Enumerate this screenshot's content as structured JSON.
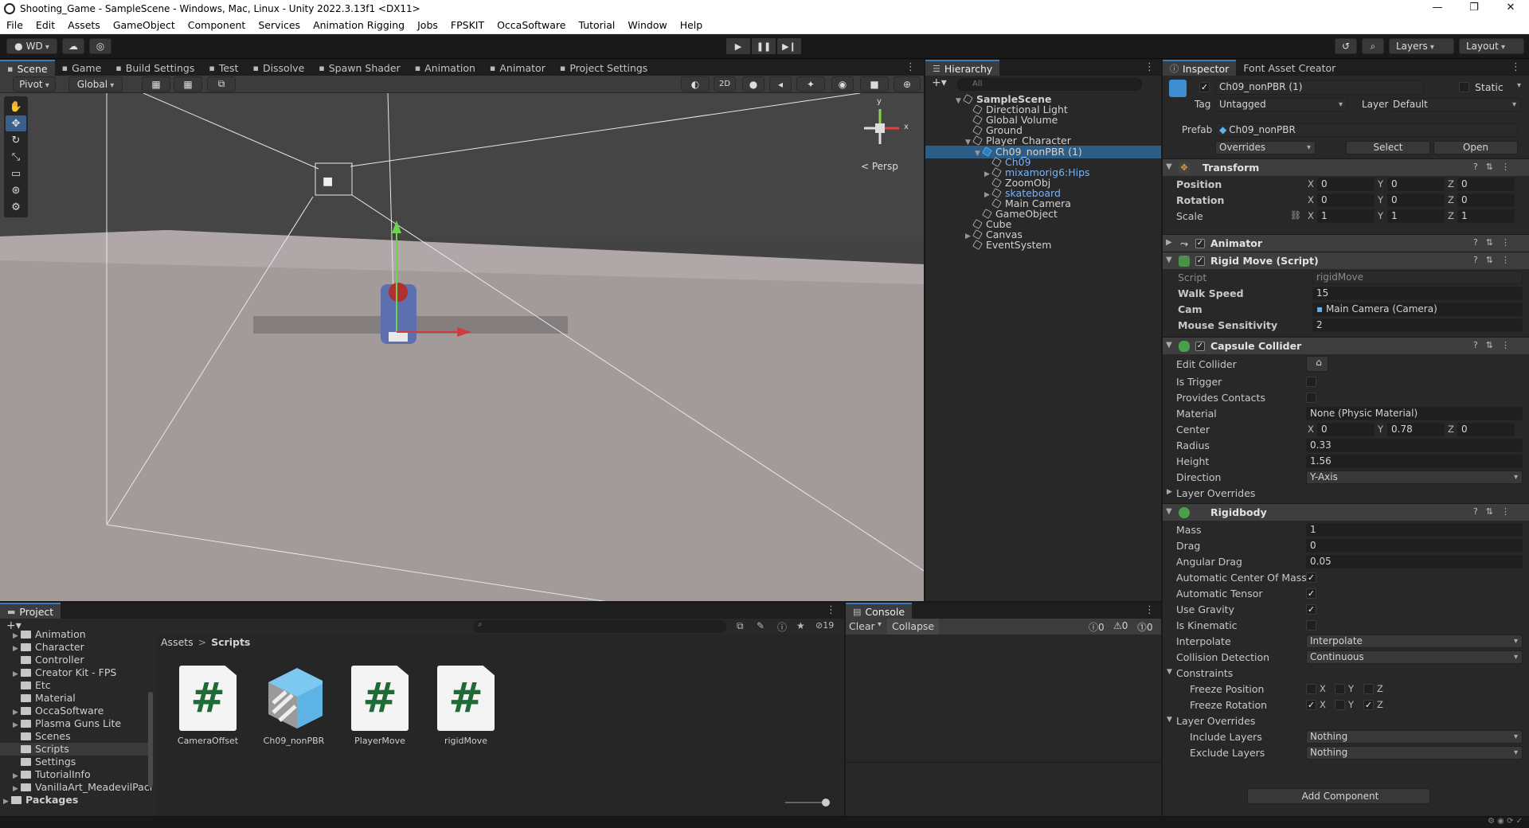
{
  "window": {
    "title": "Shooting_Game - SampleScene - Windows, Mac, Linux - Unity 2022.3.13f1 <DX11>",
    "controls": [
      "—",
      "❐",
      "✕"
    ]
  },
  "menu": [
    "File",
    "Edit",
    "Assets",
    "GameObject",
    "Component",
    "Services",
    "Animation Rigging",
    "Jobs",
    "FPSKIT",
    "OccaSoftware",
    "Tutorial",
    "Window",
    "Help"
  ],
  "toolbar": {
    "account": "WD",
    "layers": "Layers",
    "layout": "Layout"
  },
  "scene_tabs": [
    "Scene",
    "Game",
    "Build Settings",
    "Test",
    "Dissolve",
    "Spawn Shader",
    "Animation",
    "Animator",
    "Project Settings"
  ],
  "scene_toolbar": {
    "pivot": "Pivot",
    "global": "Global",
    "mode_2d": "2D",
    "persp_label": "< Persp",
    "gizmo_y": "y",
    "gizmo_x": "x"
  },
  "hierarchy": {
    "tab": "Hierarchy",
    "search_placeholder": "All",
    "rows": [
      {
        "label": "SampleScene",
        "depth": 0,
        "arrow": "▼",
        "kind": "scene"
      },
      {
        "label": "Directional Light",
        "depth": 1,
        "arrow": "",
        "kind": "obj"
      },
      {
        "label": "Global Volume",
        "depth": 1,
        "arrow": "",
        "kind": "obj"
      },
      {
        "label": "Ground",
        "depth": 1,
        "arrow": "",
        "kind": "obj"
      },
      {
        "label": "Player_Character",
        "depth": 1,
        "arrow": "▼",
        "kind": "obj"
      },
      {
        "label": "Ch09_nonPBR (1)",
        "depth": 2,
        "arrow": "▼",
        "kind": "prefab-sel"
      },
      {
        "label": "Ch09",
        "depth": 3,
        "arrow": "",
        "kind": "prefab"
      },
      {
        "label": "mixamorig6:Hips",
        "depth": 3,
        "arrow": "▶",
        "kind": "prefab"
      },
      {
        "label": "ZoomObj",
        "depth": 3,
        "arrow": "",
        "kind": "obj"
      },
      {
        "label": "skateboard",
        "depth": 3,
        "arrow": "▶",
        "kind": "prefab"
      },
      {
        "label": "Main Camera",
        "depth": 3,
        "arrow": "",
        "kind": "obj"
      },
      {
        "label": "GameObject",
        "depth": 2,
        "arrow": "",
        "kind": "obj"
      },
      {
        "label": "Cube",
        "depth": 1,
        "arrow": "",
        "kind": "obj"
      },
      {
        "label": "Canvas",
        "depth": 1,
        "arrow": "▶",
        "kind": "obj"
      },
      {
        "label": "EventSystem",
        "depth": 1,
        "arrow": "",
        "kind": "obj"
      }
    ]
  },
  "inspector": {
    "tabs": [
      "Inspector",
      "Font Asset Creator"
    ],
    "object_name": "Ch09_nonPBR (1)",
    "static_label": "Static",
    "tag_label": "Tag",
    "tag_value": "Untagged",
    "layer_label": "Layer",
    "layer_value": "Default",
    "prefab_label": "Prefab",
    "prefab_value": "Ch09_nonPBR",
    "overrides": "Overrides",
    "select": "Select",
    "open": "Open",
    "transform": {
      "title": "Transform",
      "position_label": "Position",
      "rotation_label": "Rotation",
      "scale_label": "Scale",
      "position": [
        "0",
        "0",
        "0"
      ],
      "rotation": [
        "0",
        "0",
        "0"
      ],
      "scale": [
        "1",
        "1",
        "1"
      ]
    },
    "animator": {
      "title": "Animator"
    },
    "rigid_move": {
      "title": "Rigid Move (Script)",
      "script_label": "Script",
      "script_value": "rigidMove",
      "walk_speed_label": "Walk Speed",
      "walk_speed": "15",
      "cam_label": "Cam",
      "cam_value": "Main Camera (Camera)",
      "mouse_label": "Mouse Sensitivity",
      "mouse_value": "2"
    },
    "capsule": {
      "title": "Capsule Collider",
      "edit_collider": "Edit Collider",
      "is_trigger": "Is Trigger",
      "provides_contacts": "Provides Contacts",
      "material_label": "Material",
      "material_value": "None (Physic Material)",
      "center_label": "Center",
      "center": [
        "0",
        "0.78",
        "0"
      ],
      "radius_label": "Radius",
      "radius": "0.33",
      "height_label": "Height",
      "height": "1.56",
      "direction_label": "Direction",
      "direction": "Y-Axis",
      "layer_overrides": "Layer Overrides"
    },
    "rigidbody": {
      "title": "Rigidbody",
      "mass_label": "Mass",
      "mass": "1",
      "drag_label": "Drag",
      "drag": "0",
      "angular_label": "Angular Drag",
      "angular": "0.05",
      "auto_com": "Automatic Center Of Mass",
      "auto_tensor": "Automatic Tensor",
      "use_gravity": "Use Gravity",
      "is_kinematic": "Is Kinematic",
      "interpolate_label": "Interpolate",
      "interpolate": "Interpolate",
      "collision_label": "Collision Detection",
      "collision": "Continuous",
      "constraints": "Constraints",
      "freeze_pos": "Freeze Position",
      "freeze_rot": "Freeze Rotation",
      "layer_overrides": "Layer Overrides",
      "include_label": "Include Layers",
      "include": "Nothing",
      "exclude_label": "Exclude Layers",
      "exclude": "Nothing"
    },
    "add_component": "Add Component"
  },
  "project": {
    "tab": "Project",
    "tree": [
      "Animation",
      "Character",
      "Controller",
      "Creator Kit - FPS",
      "Etc",
      "Material",
      "OccaSoftware",
      "Plasma Guns Lite",
      "Scenes",
      "Scripts",
      "Settings",
      "TutorialInfo",
      "VanillaArt_MeadevilPacl"
    ],
    "packages": "Packages",
    "breadcrumb_root": "Assets",
    "breadcrumb_sep": ">",
    "breadcrumb_current": "Scripts",
    "hidden_count": "19",
    "assets": [
      {
        "name": "CameraOffset",
        "kind": "cs"
      },
      {
        "name": "Ch09_nonPBR",
        "kind": "prefab"
      },
      {
        "name": "PlayerMove",
        "kind": "cs"
      },
      {
        "name": "rigidMove",
        "kind": "cs"
      }
    ]
  },
  "console": {
    "tab": "Console",
    "clear": "Clear",
    "collapse": "Collapse",
    "log_count": "0",
    "warn_count": "0",
    "error_count": "0"
  },
  "symbols": {
    "hash": "#",
    "check": "✓",
    "axis_x": "X",
    "axis_y": "Y",
    "axis_z": "Z",
    "play": "▶",
    "pause": "❚❚",
    "step": "▶❙",
    "kebab": "⋮",
    "history_icon": "↺",
    "search_icon": "⌕"
  }
}
